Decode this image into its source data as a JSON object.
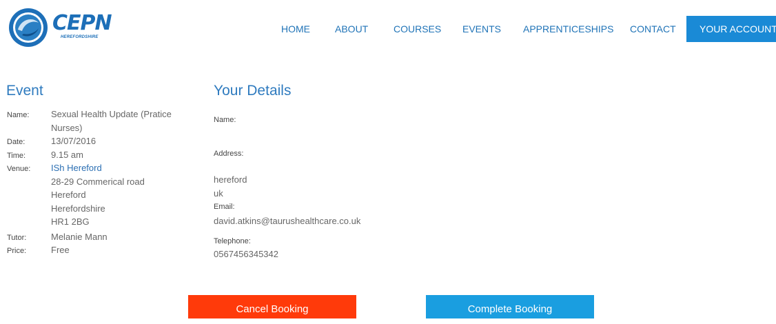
{
  "brand": {
    "name": "CEPN",
    "sub": "HEREFORDSHIRE",
    "colors": {
      "primary": "#1d6fb8",
      "accent": "#1a8ad6",
      "cancel": "#ff3a0a",
      "complete": "#1a9ee0"
    }
  },
  "nav": {
    "items": [
      "HOME",
      "ABOUT",
      "COURSES",
      "EVENTS",
      "APPRENTICESHIPS",
      "CONTACT"
    ],
    "account": "YOUR ACCOUNT"
  },
  "event": {
    "heading": "Event",
    "name_label": "Name:",
    "name_lines": [
      "Sexual Health Update (Pratice",
      "Nurses)"
    ],
    "date_label": "Date:",
    "date": "13/07/2016",
    "time_label": "Time:",
    "time": "9.15 am",
    "venue_label": "Venue:",
    "venue_name": "ISh Hereford",
    "venue_lines": [
      "28-29 Commerical road",
      "Hereford",
      "Herefordshire",
      "HR1 2BG"
    ],
    "tutor_label": "Tutor:",
    "tutor": "Melanie Mann",
    "price_label": "Price:",
    "price": "Free"
  },
  "details": {
    "heading": "Your Details",
    "name_label": "Name:",
    "address_label": "Address:",
    "address_lines": [
      "hereford",
      "uk"
    ],
    "email_label": "Email:",
    "email": "david.atkins@taurushealthcare.co.uk",
    "telephone_label": "Telephone:",
    "telephone": "0567456345342"
  },
  "buttons": {
    "cancel": "Cancel Booking",
    "complete": "Complete Booking"
  }
}
